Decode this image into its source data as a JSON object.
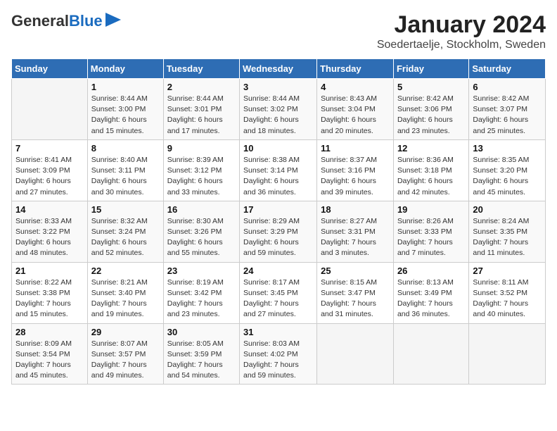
{
  "logo": {
    "text_general": "General",
    "text_blue": "Blue"
  },
  "title": "January 2024",
  "subtitle": "Soedertaelje, Stockholm, Sweden",
  "headers": [
    "Sunday",
    "Monday",
    "Tuesday",
    "Wednesday",
    "Thursday",
    "Friday",
    "Saturday"
  ],
  "weeks": [
    [
      {
        "day": "",
        "info": ""
      },
      {
        "day": "1",
        "info": "Sunrise: 8:44 AM\nSunset: 3:00 PM\nDaylight: 6 hours\nand 15 minutes."
      },
      {
        "day": "2",
        "info": "Sunrise: 8:44 AM\nSunset: 3:01 PM\nDaylight: 6 hours\nand 17 minutes."
      },
      {
        "day": "3",
        "info": "Sunrise: 8:44 AM\nSunset: 3:02 PM\nDaylight: 6 hours\nand 18 minutes."
      },
      {
        "day": "4",
        "info": "Sunrise: 8:43 AM\nSunset: 3:04 PM\nDaylight: 6 hours\nand 20 minutes."
      },
      {
        "day": "5",
        "info": "Sunrise: 8:42 AM\nSunset: 3:06 PM\nDaylight: 6 hours\nand 23 minutes."
      },
      {
        "day": "6",
        "info": "Sunrise: 8:42 AM\nSunset: 3:07 PM\nDaylight: 6 hours\nand 25 minutes."
      }
    ],
    [
      {
        "day": "7",
        "info": "Sunrise: 8:41 AM\nSunset: 3:09 PM\nDaylight: 6 hours\nand 27 minutes."
      },
      {
        "day": "8",
        "info": "Sunrise: 8:40 AM\nSunset: 3:11 PM\nDaylight: 6 hours\nand 30 minutes."
      },
      {
        "day": "9",
        "info": "Sunrise: 8:39 AM\nSunset: 3:12 PM\nDaylight: 6 hours\nand 33 minutes."
      },
      {
        "day": "10",
        "info": "Sunrise: 8:38 AM\nSunset: 3:14 PM\nDaylight: 6 hours\nand 36 minutes."
      },
      {
        "day": "11",
        "info": "Sunrise: 8:37 AM\nSunset: 3:16 PM\nDaylight: 6 hours\nand 39 minutes."
      },
      {
        "day": "12",
        "info": "Sunrise: 8:36 AM\nSunset: 3:18 PM\nDaylight: 6 hours\nand 42 minutes."
      },
      {
        "day": "13",
        "info": "Sunrise: 8:35 AM\nSunset: 3:20 PM\nDaylight: 6 hours\nand 45 minutes."
      }
    ],
    [
      {
        "day": "14",
        "info": "Sunrise: 8:33 AM\nSunset: 3:22 PM\nDaylight: 6 hours\nand 48 minutes."
      },
      {
        "day": "15",
        "info": "Sunrise: 8:32 AM\nSunset: 3:24 PM\nDaylight: 6 hours\nand 52 minutes."
      },
      {
        "day": "16",
        "info": "Sunrise: 8:30 AM\nSunset: 3:26 PM\nDaylight: 6 hours\nand 55 minutes."
      },
      {
        "day": "17",
        "info": "Sunrise: 8:29 AM\nSunset: 3:29 PM\nDaylight: 6 hours\nand 59 minutes."
      },
      {
        "day": "18",
        "info": "Sunrise: 8:27 AM\nSunset: 3:31 PM\nDaylight: 7 hours\nand 3 minutes."
      },
      {
        "day": "19",
        "info": "Sunrise: 8:26 AM\nSunset: 3:33 PM\nDaylight: 7 hours\nand 7 minutes."
      },
      {
        "day": "20",
        "info": "Sunrise: 8:24 AM\nSunset: 3:35 PM\nDaylight: 7 hours\nand 11 minutes."
      }
    ],
    [
      {
        "day": "21",
        "info": "Sunrise: 8:22 AM\nSunset: 3:38 PM\nDaylight: 7 hours\nand 15 minutes."
      },
      {
        "day": "22",
        "info": "Sunrise: 8:21 AM\nSunset: 3:40 PM\nDaylight: 7 hours\nand 19 minutes."
      },
      {
        "day": "23",
        "info": "Sunrise: 8:19 AM\nSunset: 3:42 PM\nDaylight: 7 hours\nand 23 minutes."
      },
      {
        "day": "24",
        "info": "Sunrise: 8:17 AM\nSunset: 3:45 PM\nDaylight: 7 hours\nand 27 minutes."
      },
      {
        "day": "25",
        "info": "Sunrise: 8:15 AM\nSunset: 3:47 PM\nDaylight: 7 hours\nand 31 minutes."
      },
      {
        "day": "26",
        "info": "Sunrise: 8:13 AM\nSunset: 3:49 PM\nDaylight: 7 hours\nand 36 minutes."
      },
      {
        "day": "27",
        "info": "Sunrise: 8:11 AM\nSunset: 3:52 PM\nDaylight: 7 hours\nand 40 minutes."
      }
    ],
    [
      {
        "day": "28",
        "info": "Sunrise: 8:09 AM\nSunset: 3:54 PM\nDaylight: 7 hours\nand 45 minutes."
      },
      {
        "day": "29",
        "info": "Sunrise: 8:07 AM\nSunset: 3:57 PM\nDaylight: 7 hours\nand 49 minutes."
      },
      {
        "day": "30",
        "info": "Sunrise: 8:05 AM\nSunset: 3:59 PM\nDaylight: 7 hours\nand 54 minutes."
      },
      {
        "day": "31",
        "info": "Sunrise: 8:03 AM\nSunset: 4:02 PM\nDaylight: 7 hours\nand 59 minutes."
      },
      {
        "day": "",
        "info": ""
      },
      {
        "day": "",
        "info": ""
      },
      {
        "day": "",
        "info": ""
      }
    ]
  ]
}
